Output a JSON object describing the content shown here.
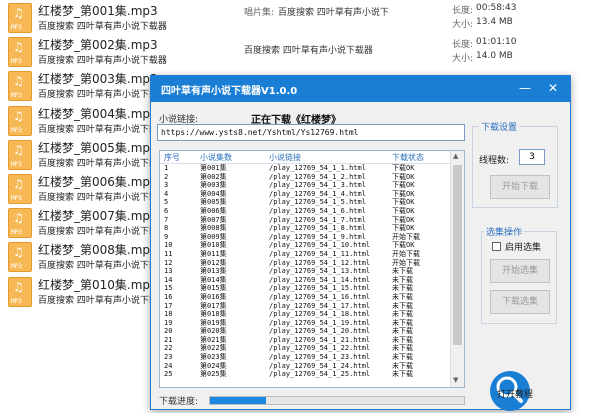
{
  "explorer": {
    "files": [
      {
        "name": "红楼梦_第001集.mp3",
        "sub": "百度搜索 四叶草有声小说下载器",
        "album_label": "唱片集:",
        "album": "百度搜索 四叶草有声小说下",
        "duration_label": "长度:",
        "duration": "00:58:43",
        "size_label": "大小:",
        "size": "13.4 MB"
      },
      {
        "name": "红楼梦_第002集.mp3",
        "sub": "百度搜索 四叶草有声小说下载器",
        "album_label": "唱片集:",
        "album": "百度搜索 四叶草有声小说下载器",
        "duration_label": "长度:",
        "duration": "01:01:10",
        "size_label": "大小:",
        "size": "14.0 MB"
      },
      {
        "name": "红楼梦_第003集.mp3",
        "sub": "百度搜索 四叶草有声小说下载器"
      },
      {
        "name": "红楼梦_第004集.mp3",
        "sub": "百度搜索 四叶草有声小说下载器"
      },
      {
        "name": "红楼梦_第005集.mp3",
        "sub": "百度搜索 四叶草有声小说下载器"
      },
      {
        "name": "红楼梦_第006集.mp3",
        "sub": "百度搜索 四叶草有声小说下载器"
      },
      {
        "name": "红楼梦_第007集.mp3",
        "sub": "百度搜索 四叶草有声小说下载器"
      },
      {
        "name": "红楼梦_第008集.mp3",
        "sub": "百度搜索 四叶草有声小说下载器"
      },
      {
        "name": "红楼梦_第010集.mp3",
        "sub": "百度搜索 四叶草有声小说下载器"
      }
    ],
    "icon_ext": "MP3",
    "icon": "music-file-icon"
  },
  "app": {
    "title": "四叶草有声小说下载器V1.0.0",
    "minimize_glyph": "—",
    "close_glyph": "✕",
    "url_label": "小说链接:",
    "status": "正在下载《红楼梦》",
    "url": "https://www.ysts8.net/Yshtml/Ys12769.html",
    "columns": {
      "no": "序号",
      "episode": "小说集数",
      "link": "小说链接",
      "state": "下载状态"
    },
    "rows": [
      {
        "no": "1",
        "ep": "第001集",
        "link": "/play_12769_54_1_1.html",
        "st": "下载OK"
      },
      {
        "no": "2",
        "ep": "第002集",
        "link": "/play_12769_54_1_2.html",
        "st": "下载OK"
      },
      {
        "no": "3",
        "ep": "第003集",
        "link": "/play_12769_54_1_3.html",
        "st": "下载OK"
      },
      {
        "no": "4",
        "ep": "第004集",
        "link": "/play_12769_54_1_4.html",
        "st": "下载OK"
      },
      {
        "no": "5",
        "ep": "第005集",
        "link": "/play_12769_54_1_5.html",
        "st": "下载OK"
      },
      {
        "no": "6",
        "ep": "第006集",
        "link": "/play_12769_54_1_6.html",
        "st": "下载OK"
      },
      {
        "no": "7",
        "ep": "第007集",
        "link": "/play_12769_54_1_7.html",
        "st": "下载OK"
      },
      {
        "no": "8",
        "ep": "第008集",
        "link": "/play_12769_54_1_8.html",
        "st": "下载OK"
      },
      {
        "no": "9",
        "ep": "第009集",
        "link": "/play_12769_54_1_9.html",
        "st": "开始下载"
      },
      {
        "no": "10",
        "ep": "第010集",
        "link": "/play_12769_54_1_10.html",
        "st": "下载OK"
      },
      {
        "no": "11",
        "ep": "第011集",
        "link": "/play_12769_54_1_11.html",
        "st": "开始下载"
      },
      {
        "no": "12",
        "ep": "第012集",
        "link": "/play_12769_54_1_12.html",
        "st": "开始下载"
      },
      {
        "no": "13",
        "ep": "第013集",
        "link": "/play_12769_54_1_13.html",
        "st": "未下载"
      },
      {
        "no": "14",
        "ep": "第014集",
        "link": "/play_12769_54_1_14.html",
        "st": "未下载"
      },
      {
        "no": "15",
        "ep": "第015集",
        "link": "/play_12769_54_1_15.html",
        "st": "未下载"
      },
      {
        "no": "16",
        "ep": "第016集",
        "link": "/play_12769_54_1_16.html",
        "st": "未下载"
      },
      {
        "no": "17",
        "ep": "第017集",
        "link": "/play_12769_54_1_17.html",
        "st": "未下载"
      },
      {
        "no": "18",
        "ep": "第018集",
        "link": "/play_12769_54_1_18.html",
        "st": "未下载"
      },
      {
        "no": "19",
        "ep": "第019集",
        "link": "/play_12769_54_1_19.html",
        "st": "未下载"
      },
      {
        "no": "20",
        "ep": "第020集",
        "link": "/play_12769_54_1_20.html",
        "st": "未下载"
      },
      {
        "no": "21",
        "ep": "第021集",
        "link": "/play_12769_54_1_21.html",
        "st": "未下载"
      },
      {
        "no": "22",
        "ep": "第022集",
        "link": "/play_12769_54_1_22.html",
        "st": "未下载"
      },
      {
        "no": "23",
        "ep": "第023集",
        "link": "/play_12769_54_1_23.html",
        "st": "未下载"
      },
      {
        "no": "24",
        "ep": "第024集",
        "link": "/play_12769_54_1_24.html",
        "st": "未下载"
      },
      {
        "no": "25",
        "ep": "第025集",
        "link": "/play_12769_54_1_25.html",
        "st": "未下载"
      }
    ],
    "progress_label": "下载进度:",
    "progress": 0.22,
    "download_settings": {
      "legend": "下载设置",
      "threads_label": "线程数:",
      "threads": "3",
      "start_button": "开始下载"
    },
    "selection_ops": {
      "legend": "选集操作",
      "checkbox_label": "启用选集",
      "start_select_button": "开始选集",
      "download_select_button": "下载选集"
    },
    "tutorial_button": "打开教程",
    "accent": "#1a7fd4"
  }
}
